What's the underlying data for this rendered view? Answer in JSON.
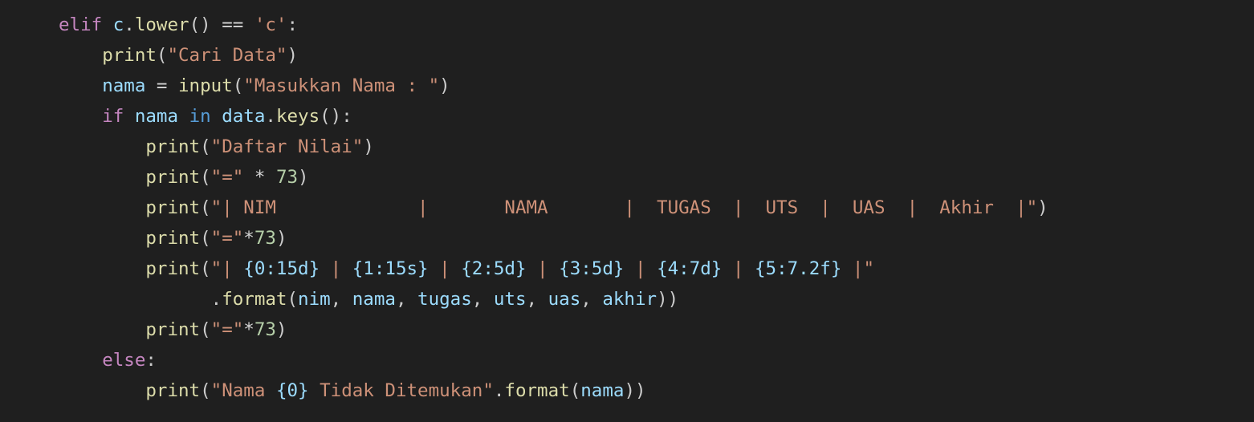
{
  "editor": {
    "background": "#1f1f1f",
    "colors": {
      "keyword": "#c586c0",
      "function": "#dcdcaa",
      "variable": "#9cdcfe",
      "string": "#ce9178",
      "number": "#b5cea8",
      "operator_in": "#569cd6",
      "text": "#cccccc"
    },
    "lines": [
      {
        "indent": "",
        "tokens": [
          {
            "t": "kw",
            "v": "elif"
          },
          {
            "t": "pun",
            "v": " "
          },
          {
            "t": "var",
            "v": "c"
          },
          {
            "t": "pun",
            "v": "."
          },
          {
            "t": "fn",
            "v": "lower"
          },
          {
            "t": "pun",
            "v": "() "
          },
          {
            "t": "op",
            "v": "=="
          },
          {
            "t": "pun",
            "v": " "
          },
          {
            "t": "str",
            "v": "'c'"
          },
          {
            "t": "pun",
            "v": ":"
          }
        ]
      },
      {
        "indent": "    ",
        "tokens": [
          {
            "t": "fn",
            "v": "print"
          },
          {
            "t": "pun",
            "v": "("
          },
          {
            "t": "str",
            "v": "\"Cari Data\""
          },
          {
            "t": "pun",
            "v": ")"
          }
        ]
      },
      {
        "indent": "    ",
        "tokens": [
          {
            "t": "var",
            "v": "nama"
          },
          {
            "t": "pun",
            "v": " "
          },
          {
            "t": "op",
            "v": "="
          },
          {
            "t": "pun",
            "v": " "
          },
          {
            "t": "fn",
            "v": "input"
          },
          {
            "t": "pun",
            "v": "("
          },
          {
            "t": "str",
            "v": "\"Masukkan Nama : \""
          },
          {
            "t": "pun",
            "v": ")"
          }
        ]
      },
      {
        "indent": "    ",
        "tokens": [
          {
            "t": "kw",
            "v": "if"
          },
          {
            "t": "pun",
            "v": " "
          },
          {
            "t": "var",
            "v": "nama"
          },
          {
            "t": "pun",
            "v": " "
          },
          {
            "t": "in",
            "v": "in"
          },
          {
            "t": "pun",
            "v": " "
          },
          {
            "t": "var",
            "v": "data"
          },
          {
            "t": "pun",
            "v": "."
          },
          {
            "t": "fn",
            "v": "keys"
          },
          {
            "t": "pun",
            "v": "():"
          }
        ]
      },
      {
        "indent": "        ",
        "tokens": [
          {
            "t": "fn",
            "v": "print"
          },
          {
            "t": "pun",
            "v": "("
          },
          {
            "t": "str",
            "v": "\"Daftar Nilai\""
          },
          {
            "t": "pun",
            "v": ")"
          }
        ]
      },
      {
        "indent": "        ",
        "tokens": [
          {
            "t": "fn",
            "v": "print"
          },
          {
            "t": "pun",
            "v": "("
          },
          {
            "t": "str",
            "v": "\"=\""
          },
          {
            "t": "pun",
            "v": " "
          },
          {
            "t": "op",
            "v": "*"
          },
          {
            "t": "pun",
            "v": " "
          },
          {
            "t": "num",
            "v": "73"
          },
          {
            "t": "pun",
            "v": ")"
          }
        ]
      },
      {
        "indent": "        ",
        "tokens": [
          {
            "t": "fn",
            "v": "print"
          },
          {
            "t": "pun",
            "v": "("
          },
          {
            "t": "str",
            "v": "\"| NIM             |       NAMA       |  TUGAS  |  UTS  |  UAS  |  Akhir  |\""
          },
          {
            "t": "pun",
            "v": ")"
          }
        ]
      },
      {
        "indent": "        ",
        "tokens": [
          {
            "t": "fn",
            "v": "print"
          },
          {
            "t": "pun",
            "v": "("
          },
          {
            "t": "str",
            "v": "\"=\""
          },
          {
            "t": "op",
            "v": "*"
          },
          {
            "t": "num",
            "v": "73"
          },
          {
            "t": "pun",
            "v": ")"
          }
        ]
      },
      {
        "indent": "        ",
        "tokens": [
          {
            "t": "fn",
            "v": "print"
          },
          {
            "t": "pun",
            "v": "("
          },
          {
            "t": "str",
            "v": "\"| "
          },
          {
            "t": "fmt",
            "v": "{0:15d}"
          },
          {
            "t": "str",
            "v": " | "
          },
          {
            "t": "fmt",
            "v": "{1:15s}"
          },
          {
            "t": "str",
            "v": " | "
          },
          {
            "t": "fmt",
            "v": "{2:5d}"
          },
          {
            "t": "str",
            "v": " | "
          },
          {
            "t": "fmt",
            "v": "{3:5d}"
          },
          {
            "t": "str",
            "v": " | "
          },
          {
            "t": "fmt",
            "v": "{4:7d}"
          },
          {
            "t": "str",
            "v": " | "
          },
          {
            "t": "fmt",
            "v": "{5:7.2f}"
          },
          {
            "t": "str",
            "v": " |\""
          }
        ]
      },
      {
        "indent": "              ",
        "tokens": [
          {
            "t": "pun",
            "v": "."
          },
          {
            "t": "fn",
            "v": "format"
          },
          {
            "t": "pun",
            "v": "("
          },
          {
            "t": "var",
            "v": "nim"
          },
          {
            "t": "pun",
            "v": ", "
          },
          {
            "t": "var",
            "v": "nama"
          },
          {
            "t": "pun",
            "v": ", "
          },
          {
            "t": "var",
            "v": "tugas"
          },
          {
            "t": "pun",
            "v": ", "
          },
          {
            "t": "var",
            "v": "uts"
          },
          {
            "t": "pun",
            "v": ", "
          },
          {
            "t": "var",
            "v": "uas"
          },
          {
            "t": "pun",
            "v": ", "
          },
          {
            "t": "var",
            "v": "akhir"
          },
          {
            "t": "pun",
            "v": "))"
          }
        ]
      },
      {
        "indent": "        ",
        "tokens": [
          {
            "t": "fn",
            "v": "print"
          },
          {
            "t": "pun",
            "v": "("
          },
          {
            "t": "str",
            "v": "\"=\""
          },
          {
            "t": "op",
            "v": "*"
          },
          {
            "t": "num",
            "v": "73"
          },
          {
            "t": "pun",
            "v": ")"
          }
        ]
      },
      {
        "indent": "    ",
        "tokens": [
          {
            "t": "kw",
            "v": "else"
          },
          {
            "t": "pun",
            "v": ":"
          }
        ]
      },
      {
        "indent": "        ",
        "tokens": [
          {
            "t": "fn",
            "v": "print"
          },
          {
            "t": "pun",
            "v": "("
          },
          {
            "t": "str",
            "v": "\"Nama "
          },
          {
            "t": "fmt",
            "v": "{0}"
          },
          {
            "t": "str",
            "v": " Tidak Ditemukan\""
          },
          {
            "t": "pun",
            "v": "."
          },
          {
            "t": "fn",
            "v": "format"
          },
          {
            "t": "pun",
            "v": "("
          },
          {
            "t": "var",
            "v": "nama"
          },
          {
            "t": "pun",
            "v": "))"
          }
        ]
      }
    ]
  }
}
